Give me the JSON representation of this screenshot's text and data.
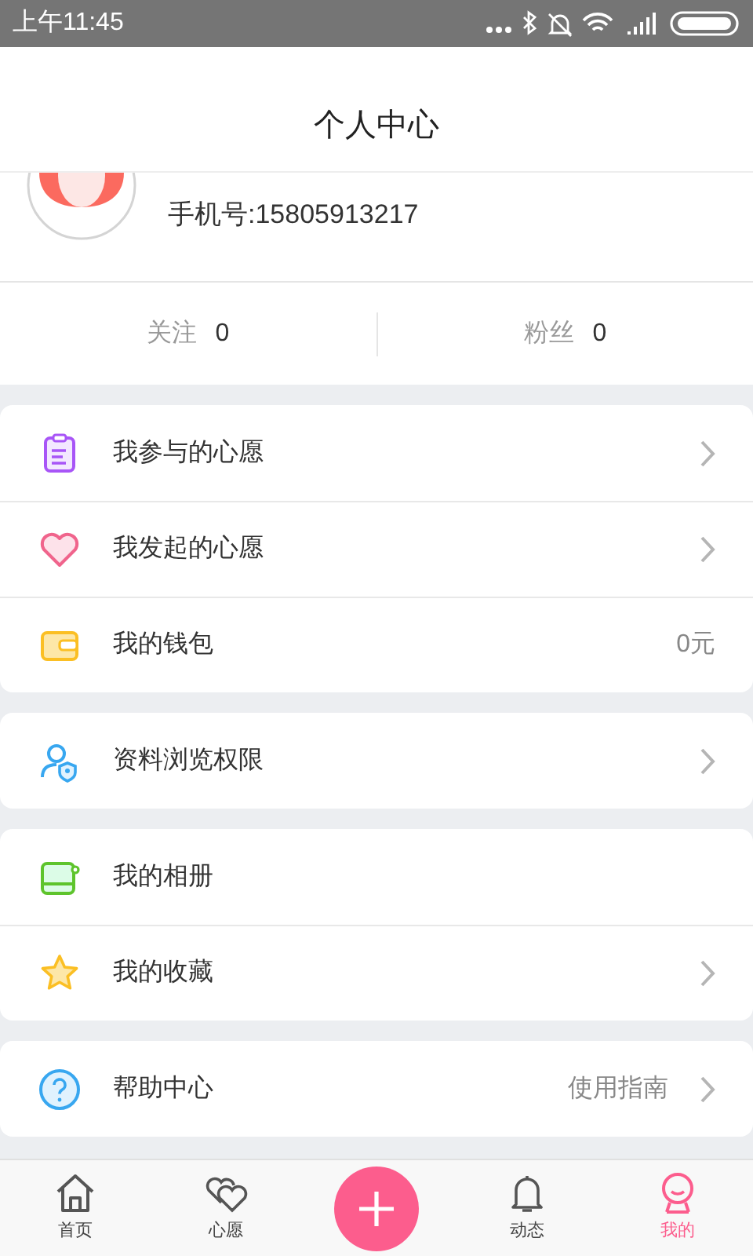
{
  "status_bar": {
    "time": "上午11:45"
  },
  "header": {
    "title": "个人中心"
  },
  "profile": {
    "phone": "手机号:15805913217"
  },
  "stats": [
    {
      "label": "关注",
      "value": "0"
    },
    {
      "label": "粉丝",
      "value": "0"
    }
  ],
  "menu_groups": [
    {
      "items": [
        {
          "kind": "clipboard",
          "label": "我参与的心愿",
          "arrow": true
        },
        {
          "kind": "heart",
          "label": "我发起的心愿",
          "arrow": true
        },
        {
          "kind": "wallet",
          "label": "我的钱包",
          "value": "0元",
          "arrow": false
        }
      ]
    },
    {
      "items": [
        {
          "kind": "user-lock",
          "label": "资料浏览权限",
          "arrow": true
        }
      ]
    },
    {
      "items": [
        {
          "kind": "album",
          "label": "我的相册",
          "arrow": false
        },
        {
          "kind": "star",
          "label": "我的收藏",
          "arrow": true
        }
      ]
    },
    {
      "items": [
        {
          "kind": "help",
          "label": "帮助中心",
          "value": "使用指南",
          "arrow": true
        }
      ]
    }
  ],
  "tab_bar": [
    {
      "kind": "home",
      "label": "首页",
      "selected": false
    },
    {
      "kind": "hearts",
      "label": "心愿",
      "selected": false
    },
    {
      "kind": "add"
    },
    {
      "kind": "bell",
      "label": "动态",
      "selected": false
    },
    {
      "kind": "me",
      "label": "我的",
      "selected": true
    }
  ]
}
